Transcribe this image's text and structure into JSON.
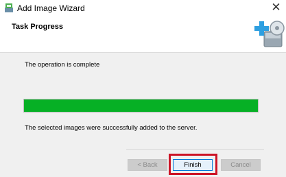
{
  "window": {
    "title": "Add Image Wizard",
    "close_glyph": "✕",
    "app_icon": "wizard-app-icon"
  },
  "header": {
    "title": "Task Progress",
    "graphic_icon": "add-image-disk-icon"
  },
  "content": {
    "status_text": "The operation is complete",
    "progress_percent": 100,
    "result_text": "The selected images were successfully added to the server."
  },
  "buttons": {
    "back": "< Back",
    "finish": "Finish",
    "cancel": "Cancel"
  },
  "colors": {
    "progress_fill": "#06b025",
    "highlight": "#cc1426",
    "focus_border": "#0078d7"
  }
}
